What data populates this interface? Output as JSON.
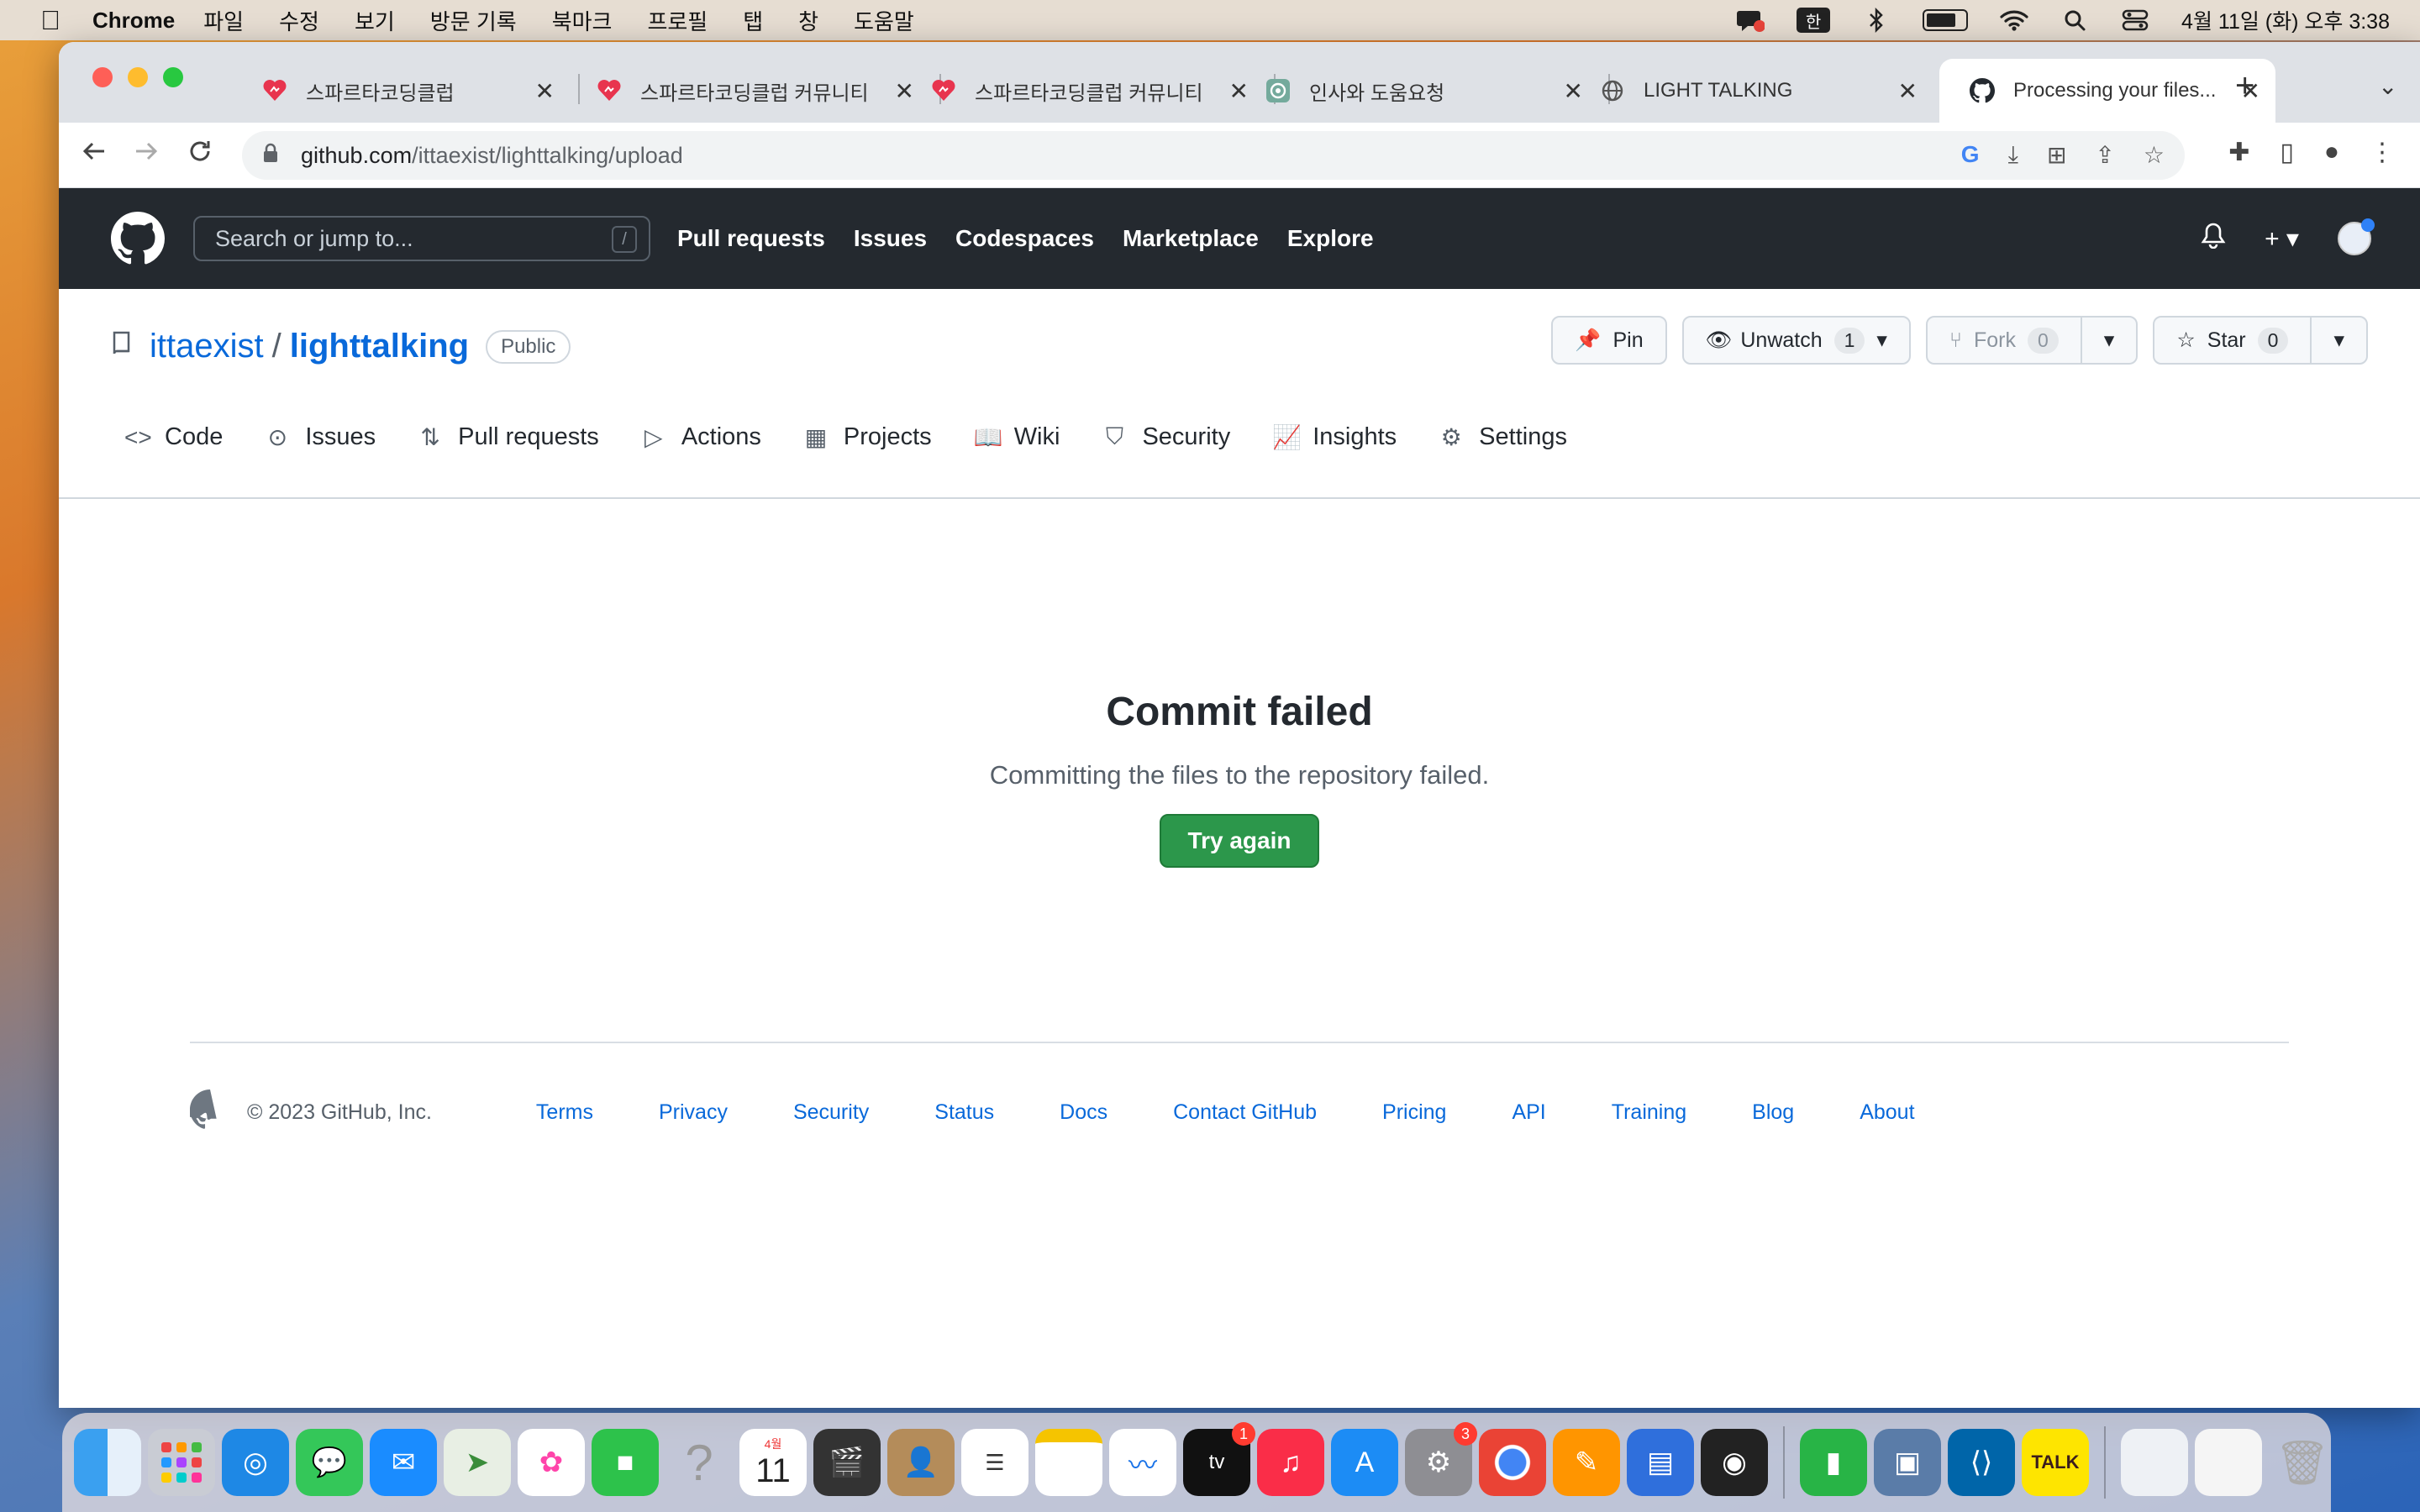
{
  "menubar": {
    "app_name": "Chrome",
    "menus": [
      "파일",
      "수정",
      "보기",
      "방문 기록",
      "북마크",
      "프로필",
      "탭",
      "창",
      "도움말"
    ],
    "input_source": "한",
    "clock": "4월 11일 (화) 오후 3:38"
  },
  "tabs": [
    {
      "title": "스파르타코딩클럽",
      "icon": "sparta-icon"
    },
    {
      "title": "스파르타코딩클럽 커뮤니티 |",
      "icon": "sparta-icon"
    },
    {
      "title": "스파르타코딩클럽 커뮤니티 |",
      "icon": "sparta-icon"
    },
    {
      "title": "인사와 도움요청",
      "icon": "chatgpt-icon"
    },
    {
      "title": "LIGHT TALKING",
      "icon": "globe-icon"
    },
    {
      "title": "Processing your files...",
      "icon": "github-icon",
      "active": true
    }
  ],
  "address_bar": {
    "host": "github.com",
    "path": "/ittaexist/lighttalking/upload"
  },
  "gh_header": {
    "search_placeholder": "Search or jump to...",
    "search_shortcut": "/",
    "nav": [
      "Pull requests",
      "Issues",
      "Codespaces",
      "Marketplace",
      "Explore"
    ]
  },
  "repo": {
    "owner": "ittaexist",
    "separator": "/",
    "name": "lighttalking",
    "visibility": "Public",
    "pin_label": "Pin",
    "unwatch_label": "Unwatch",
    "watch_count": "1",
    "fork_label": "Fork",
    "fork_count": "0",
    "star_label": "Star",
    "star_count": "0",
    "tabs": [
      "Code",
      "Issues",
      "Pull requests",
      "Actions",
      "Projects",
      "Wiki",
      "Security",
      "Insights",
      "Settings"
    ]
  },
  "main": {
    "heading": "Commit failed",
    "message": "Committing the files to the repository failed.",
    "button": "Try again"
  },
  "footer": {
    "copyright": "© 2023 GitHub, Inc.",
    "links": [
      "Terms",
      "Privacy",
      "Security",
      "Status",
      "Docs",
      "Contact GitHub",
      "Pricing",
      "API",
      "Training",
      "Blog",
      "About"
    ]
  },
  "dock": {
    "calendar_month": "4월",
    "calendar_day": "11",
    "appletv_badge": "1",
    "settings_badge": "3",
    "kakao_label": "TALK"
  },
  "colors": {
    "gh_header": "#24292f",
    "link_blue": "#0969da",
    "primary_green": "#2c974b"
  }
}
